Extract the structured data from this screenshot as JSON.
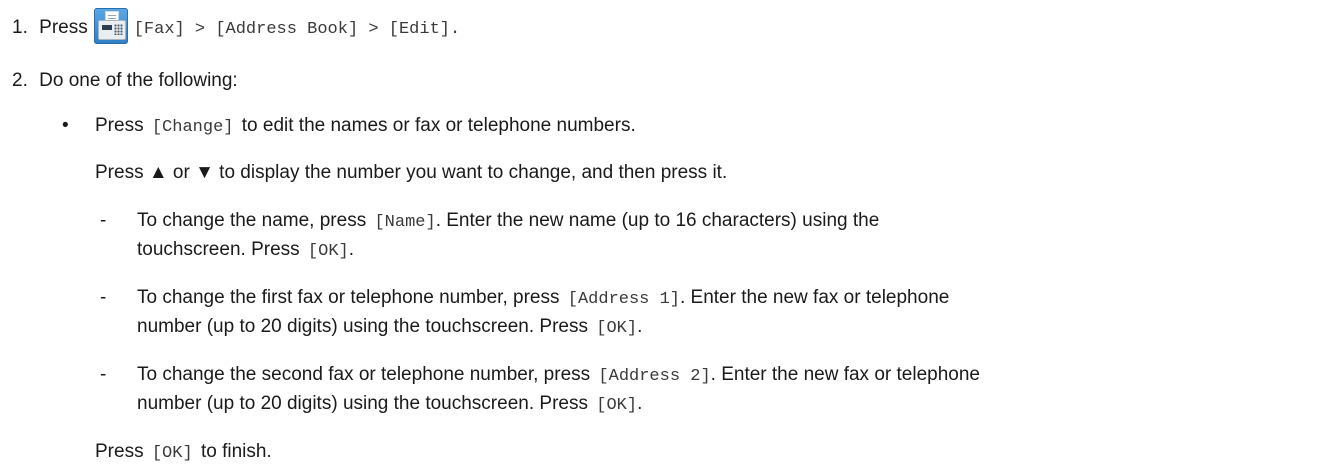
{
  "steps": {
    "step1": {
      "number": "1.",
      "press": "Press",
      "icon": "fax-icon",
      "path": "[Fax] > [Address Book] > [Edit]."
    },
    "step2": {
      "number": "2.",
      "text": "Do one of the following:"
    }
  },
  "bullet": {
    "symbol": "•",
    "press": "Press",
    "change_code": "[Change]",
    "change_text": "to edit the names or fax or telephone numbers.",
    "scroll_text": "Press ▲ or ▼ to display the number you want to change, and then press it."
  },
  "sub_items": [
    {
      "dash": "-",
      "line1_a": "To change the name, press",
      "line1_code": "[Name]",
      "line1_b": ". Enter the new name (up to 16 characters) using the",
      "line2_a": "touchscreen. Press",
      "line2_code": "[OK]",
      "line2_b": "."
    },
    {
      "dash": "-",
      "line1_a": "To change the first fax or telephone number, press",
      "line1_code": "[Address 1]",
      "line1_b": ". Enter the new fax or telephone",
      "line2_a": "number (up to 20 digits) using the touchscreen. Press",
      "line2_code": "[OK]",
      "line2_b": "."
    },
    {
      "dash": "-",
      "line1_a": "To change the second fax or telephone number, press",
      "line1_code": "[Address 2]",
      "line1_b": ". Enter the new fax or telephone",
      "line2_a": "number (up to 20 digits) using the touchscreen. Press",
      "line2_code": "[OK]",
      "line2_b": "."
    }
  ],
  "finish": {
    "press": "Press",
    "code": "[OK]",
    "text": "to finish."
  }
}
